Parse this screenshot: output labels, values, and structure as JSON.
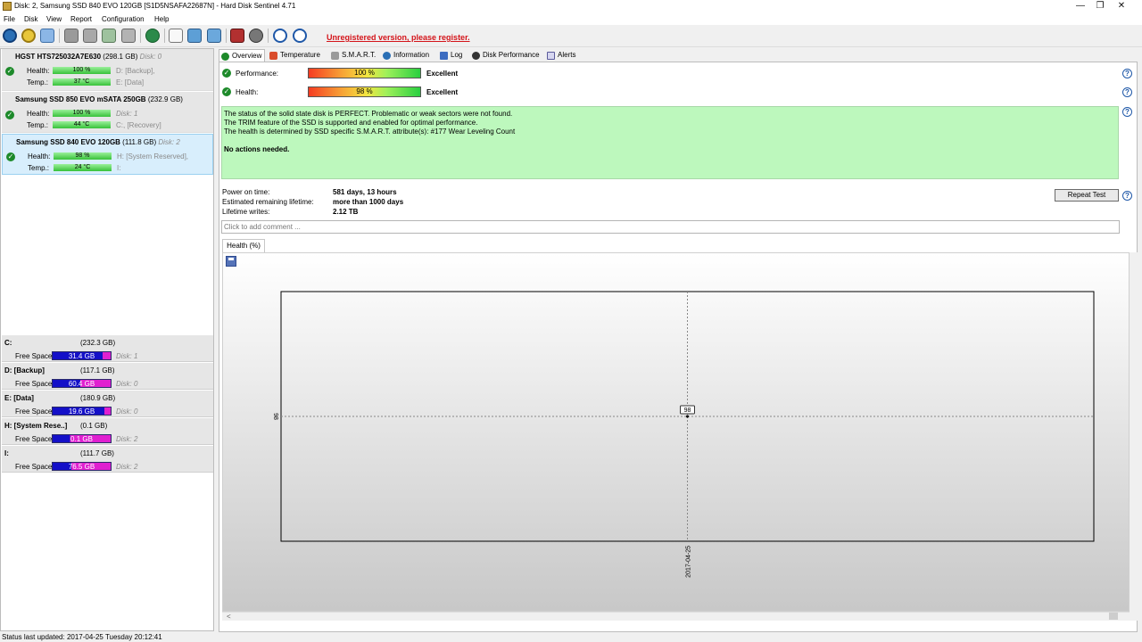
{
  "window": {
    "title": "Disk: 2, Samsung SSD 840 EVO 120GB [S1D5NSAFA22687N]  -  Hard Disk Sentinel 4.71",
    "minimize": "—",
    "restore": "❐",
    "close": "✕"
  },
  "menu": [
    "File",
    "Disk",
    "View",
    "Report",
    "Configuration",
    "Help"
  ],
  "toolbar": {
    "unregistered": "Unregistered version, please register.",
    "icons": [
      "refresh-icon",
      "disk-info-icon",
      "mail-icon",
      "disk-wrench-icon-1",
      "disk-wrench-icon-2",
      "disk-wrench-icon-3",
      "disk-wrench-icon-4",
      "globe-icon",
      "document-icon",
      "sync-icon",
      "network-icon",
      "report-icon",
      "settings-icon",
      "help-icon",
      "info-icon"
    ]
  },
  "disks": [
    {
      "name": "HGST HTS725032A7E630",
      "size": "(298.1 GB)",
      "disk": "Disk: 0",
      "health_label": "Health:",
      "health": "100 %",
      "temp_label": "Temp.:",
      "temp": "37 °C",
      "part1": "D: [Backup],",
      "part2": "E: [Data]"
    },
    {
      "name": "Samsung SSD 850 EVO mSATA 250GB",
      "size": "(232.9 GB)",
      "disk": "",
      "health_label": "Health:",
      "health": "100 %",
      "temp_label": "Temp.:",
      "temp": "44 °C",
      "part1": "Disk: 1",
      "part2": "C:, [Recovery]"
    },
    {
      "name": "Samsung SSD 840 EVO 120GB",
      "size": "(111.8 GB)",
      "disk": "Disk: 2",
      "health_label": "Health:",
      "health": "98 %",
      "temp_label": "Temp.:",
      "temp": "24 °C",
      "part1": "H: [System Reserved],",
      "part2": "I:"
    }
  ],
  "volumes": [
    {
      "name": "C:",
      "size": "(232.3 GB)",
      "free_label": "Free Space",
      "free": "31.4 GB",
      "disk": "Disk: 1",
      "used_fraction": 0.86
    },
    {
      "name": "D: [Backup]",
      "size": "(117.1 GB)",
      "free_label": "Free Space",
      "free": "60.4 GB",
      "disk": "Disk: 0",
      "used_fraction": 0.48
    },
    {
      "name": "E: [Data]",
      "size": "(180.9 GB)",
      "free_label": "Free Space",
      "free": "19.6 GB",
      "disk": "Disk: 0",
      "used_fraction": 0.89
    },
    {
      "name": "H: [System Rese..]",
      "size": "(0.1 GB)",
      "free_label": "Free Space",
      "free": "0.1 GB",
      "disk": "Disk: 2",
      "used_fraction": 0.3
    },
    {
      "name": "I:",
      "size": "(111.7 GB)",
      "free_label": "Free Space",
      "free": "76.5 GB",
      "disk": "Disk: 2",
      "used_fraction": 0.32
    }
  ],
  "tabs": [
    "Overview",
    "Temperature",
    "S.M.A.R.T.",
    "Information",
    "Log",
    "Disk Performance",
    "Alerts"
  ],
  "overview": {
    "performance_label": "Performance:",
    "performance_value": "100 %",
    "performance_text": "Excellent",
    "health_label": "Health:",
    "health_value": "98 %",
    "health_text": "Excellent",
    "status_lines": [
      "The status of the solid state disk is PERFECT. Problematic or weak sectors were not found.",
      "The TRIM feature of the SSD is supported and enabled for optimal performance.",
      "The health is determined by SSD specific S.M.A.R.T. attribute(s):  #177 Wear Leveling Count"
    ],
    "status_action": "No actions needed.",
    "power_on_label": "Power on time:",
    "power_on_value": "581 days, 13 hours",
    "remaining_label": "Estimated remaining lifetime:",
    "remaining_value": "more than 1000 days",
    "writes_label": "Lifetime writes:",
    "writes_value": "2.12 TB",
    "repeat_test": "Repeat Test",
    "comment_placeholder": "Click to add comment ...",
    "chart_tab": "Health (%)",
    "help_mark": "?"
  },
  "chart_data": {
    "type": "scatter",
    "title": "",
    "xlabel": "",
    "ylabel": "",
    "points": [
      {
        "x": "2017-04-25",
        "y": 98,
        "label": "98"
      }
    ],
    "x_ticks": [
      "2017-04-25"
    ],
    "y_ticks": [
      98
    ],
    "grid": true
  },
  "statusbar": "Status last updated: 2017-04-25 Tuesday 20:12:41"
}
